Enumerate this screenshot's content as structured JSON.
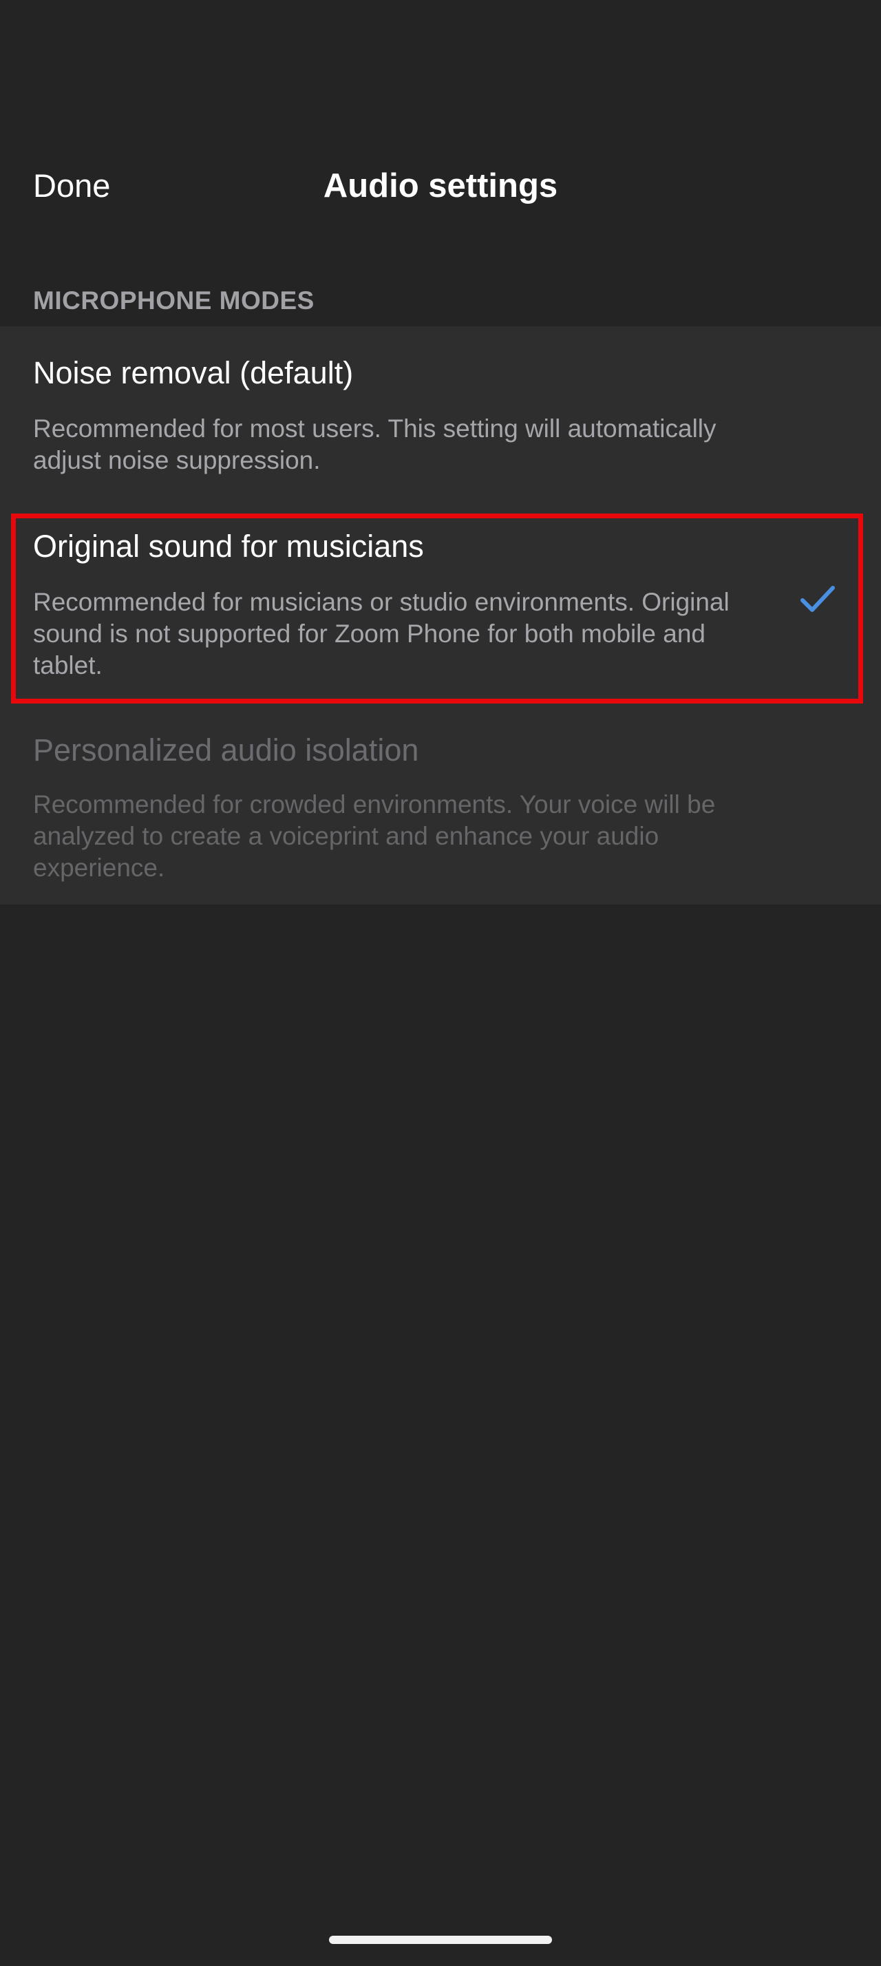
{
  "header": {
    "done_label": "Done",
    "title": "Audio settings"
  },
  "section": {
    "label": "MICROPHONE MODES"
  },
  "options": [
    {
      "title": "Noise removal (default)",
      "description": "Recommended for most users. This setting will automatically adjust noise suppression.",
      "selected": false,
      "enabled": true
    },
    {
      "title": "Original sound for musicians",
      "description": "Recommended for musicians or studio environments. Original sound is not supported for Zoom Phone for both mobile and tablet.",
      "selected": true,
      "enabled": true
    },
    {
      "title": "Personalized audio isolation",
      "description": "Recommended for crowded environments. Your voice will be analyzed to create a voiceprint and enhance your audio experience.",
      "selected": false,
      "enabled": false
    }
  ],
  "icons": {
    "selected_indicator": "checkmark-icon"
  },
  "colors": {
    "background": "#242424",
    "row_background": "#2e2e2f",
    "accent": "#4a90e2",
    "highlight": "#e8070a",
    "secondary_text": "#a7a7ab",
    "disabled_text": "#6c6c70"
  }
}
